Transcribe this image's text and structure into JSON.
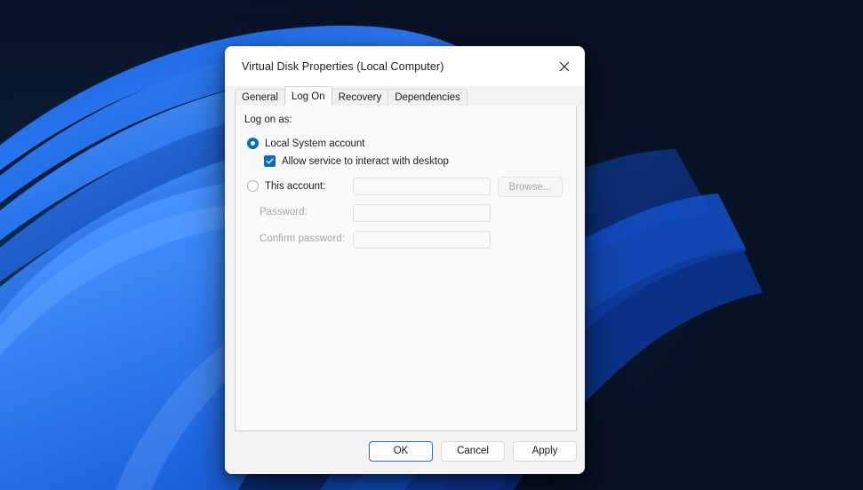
{
  "desktop": {
    "wallpaper_name": "windows-bloom-wallpaper",
    "background_color": "#081225",
    "accent_blue": "#1e6ef5"
  },
  "dialog": {
    "title": "Virtual Disk Properties (Local Computer)",
    "close_icon": "close-icon",
    "tabs": [
      {
        "label": "General",
        "selected": false
      },
      {
        "label": "Log On",
        "selected": true
      },
      {
        "label": "Recovery",
        "selected": false
      },
      {
        "label": "Dependencies",
        "selected": false
      }
    ],
    "logon": {
      "section_label": "Log on as:",
      "local_system": {
        "label": "Local System account",
        "selected": true
      },
      "allow_interact": {
        "label": "Allow service to interact with desktop",
        "checked": true,
        "check_icon": "checkmark-icon"
      },
      "this_account": {
        "label": "This account:",
        "selected": false,
        "value": "",
        "placeholder": ""
      },
      "browse_label": "Browse...",
      "password": {
        "label": "Password:",
        "value": "",
        "placeholder": "",
        "disabled": true
      },
      "confirm_password": {
        "label": "Confirm password:",
        "value": "",
        "placeholder": "",
        "disabled": true
      }
    },
    "footer": {
      "ok_label": "OK",
      "cancel_label": "Cancel",
      "apply_label": "Apply"
    },
    "colors": {
      "accent": "#0a6cc4",
      "focus_border": "#2a6fa8",
      "titlebar_bg": "#ffffff",
      "dialog_bg": "#f3f3f3",
      "panel_bg": "#fafafa",
      "disabled_text": "#a6a6a6"
    }
  }
}
